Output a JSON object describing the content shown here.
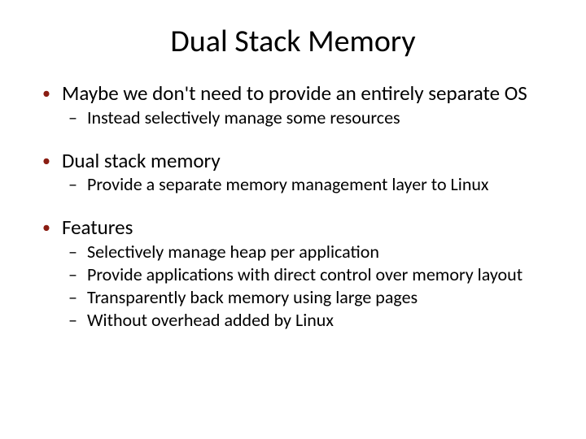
{
  "title": "Dual Stack Memory",
  "bullets": [
    {
      "text": "Maybe we don't need to provide an entirely separate OS",
      "sub": [
        "Instead selectively manage some resources"
      ]
    },
    {
      "text": "Dual stack memory",
      "sub": [
        "Provide a separate memory management layer to Linux"
      ]
    },
    {
      "text": "Features",
      "sub": [
        "Selectively manage heap per application",
        "Provide applications with direct control over memory layout",
        "Transparently back memory using large pages",
        "Without overhead added by Linux"
      ]
    }
  ]
}
